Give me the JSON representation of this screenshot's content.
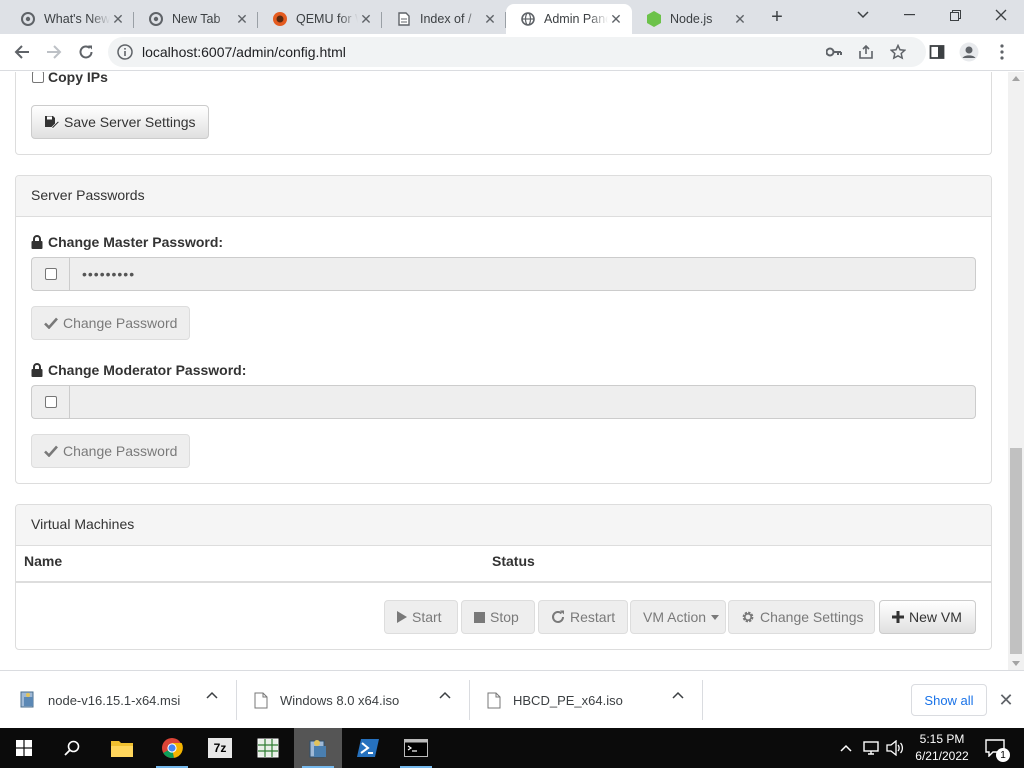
{
  "browser": {
    "tabs": [
      {
        "title": "What's New"
      },
      {
        "title": "New Tab"
      },
      {
        "title": "QEMU for Windows"
      },
      {
        "title": "Index of /"
      },
      {
        "title": "Admin Panel"
      },
      {
        "title": "Node.js"
      }
    ],
    "url": "localhost:6007/admin/config.html"
  },
  "server_settings": {
    "copy_ips_label": "Copy IPs",
    "save_button_label": "Save Server Settings"
  },
  "server_passwords": {
    "heading": "Server Passwords",
    "master_label": "Change Master Password:",
    "master_value": "•••••••••",
    "master_button_label": "Change Password",
    "moderator_label": "Change Moderator Password:",
    "moderator_value": "",
    "moderator_button_label": "Change Password"
  },
  "virtual_machines": {
    "heading": "Virtual Machines",
    "columns": [
      "Name",
      "Status"
    ],
    "buttons": {
      "start": "Start",
      "stop": "Stop",
      "restart": "Restart",
      "vm_action": "VM Action",
      "change_settings": "Change Settings",
      "new_vm": "New VM"
    }
  },
  "downloads": {
    "items": [
      {
        "name": "node-v16.15.1-x64.msi"
      },
      {
        "name": "Windows 8.0 x64.iso"
      },
      {
        "name": "HBCD_PE_x64.iso"
      }
    ],
    "show_all_label": "Show all"
  },
  "taskbar": {
    "time": "5:15 PM",
    "date": "6/21/2022",
    "notification_count": "1",
    "sevenzip_label": "7z"
  },
  "colors": {
    "chrome_frame": "#dee1e6",
    "panel_heading_bg": "#f5f5f5",
    "link_blue": "#1a73e8",
    "taskbar_bg": "#0b0b0b"
  }
}
